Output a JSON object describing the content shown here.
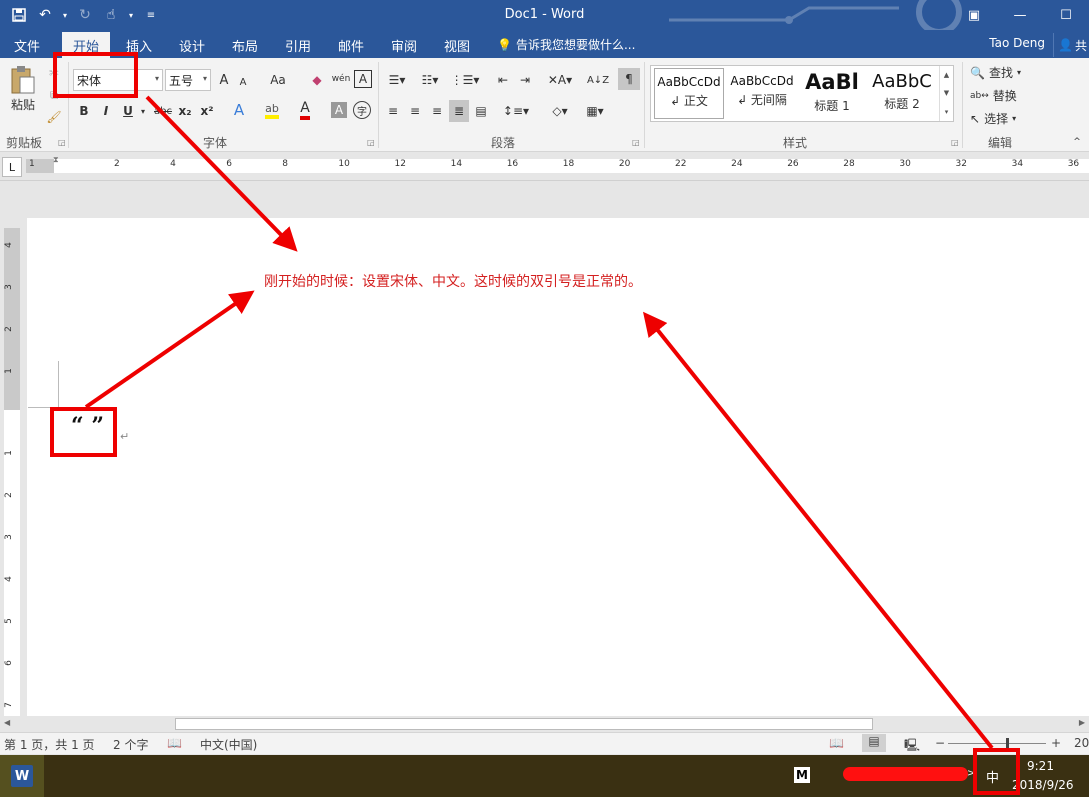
{
  "window": {
    "title": "Doc1 - Word",
    "buttons": {
      "ribbon_display": "▣",
      "minimize": "—",
      "maximize": "☐"
    }
  },
  "qat": {
    "save_icon": "save-icon",
    "undo_icon": "undo-icon",
    "redo_icon": "redo-icon",
    "touch_icon": "touch-mode-icon",
    "customize_icon": "customize-qat-icon"
  },
  "tabs": [
    "文件",
    "开始",
    "插入",
    "设计",
    "布局",
    "引用",
    "邮件",
    "审阅",
    "视图"
  ],
  "active_tab": "开始",
  "tellme": "告诉我您想要做什么...",
  "user": "Tao Deng",
  "share": "共",
  "ribbon": {
    "clipboard": {
      "label": "剪贴板",
      "paste": "粘贴"
    },
    "font": {
      "label": "字体",
      "font_name": "宋体",
      "font_size": "五号",
      "case_btn": "Aa",
      "bold": "B",
      "italic": "I",
      "underline": "U",
      "strike": "abc",
      "subscript": "x₂",
      "superscript": "x²",
      "grow": "A",
      "shrink": "A",
      "phonetic": "wén",
      "border_char": "A",
      "highlight": "ab",
      "font_color": "A",
      "shading": "A",
      "enclose": "字"
    },
    "paragraph": {
      "label": "段落"
    },
    "styles": {
      "label": "样式",
      "items": [
        {
          "sample": "AaBbCcDd",
          "name": "↲ 正文"
        },
        {
          "sample": "AaBbCcDd",
          "name": "↲ 无间隔"
        },
        {
          "sample": "AaBl",
          "name": "标题 1"
        },
        {
          "sample": "AaBbC",
          "name": "标题 2"
        }
      ]
    },
    "editing": {
      "label": "编辑",
      "find": "查找",
      "replace": "替换",
      "select": "选择"
    }
  },
  "ruler": {
    "marks": [
      "1",
      "2",
      "4",
      "6",
      "8",
      "10",
      "12",
      "14",
      "16",
      "18",
      "20",
      "22",
      "24",
      "26",
      "28",
      "30",
      "32",
      "34",
      "36"
    ],
    "vmarks": [
      "4",
      "3",
      "2",
      "1",
      "1",
      "2",
      "3",
      "4",
      "5",
      "6",
      "7"
    ]
  },
  "document": {
    "quotes": "“ ”",
    "para_mark": "↵",
    "annotation": "刚开始的时候：设置宋体、中文。这时候的双引号是正常的。"
  },
  "status": {
    "page": "第 1 页，共 1 页",
    "words": "2 个字",
    "language": "中文(中国)",
    "zoom": "20"
  },
  "taskbar": {
    "word": "W",
    "m_icon": "M",
    "ime": "中",
    "time": "9:21",
    "date": "2018/9/26"
  },
  "colors": {
    "word_blue": "#2b579a",
    "annotation_red": "#e00000"
  }
}
